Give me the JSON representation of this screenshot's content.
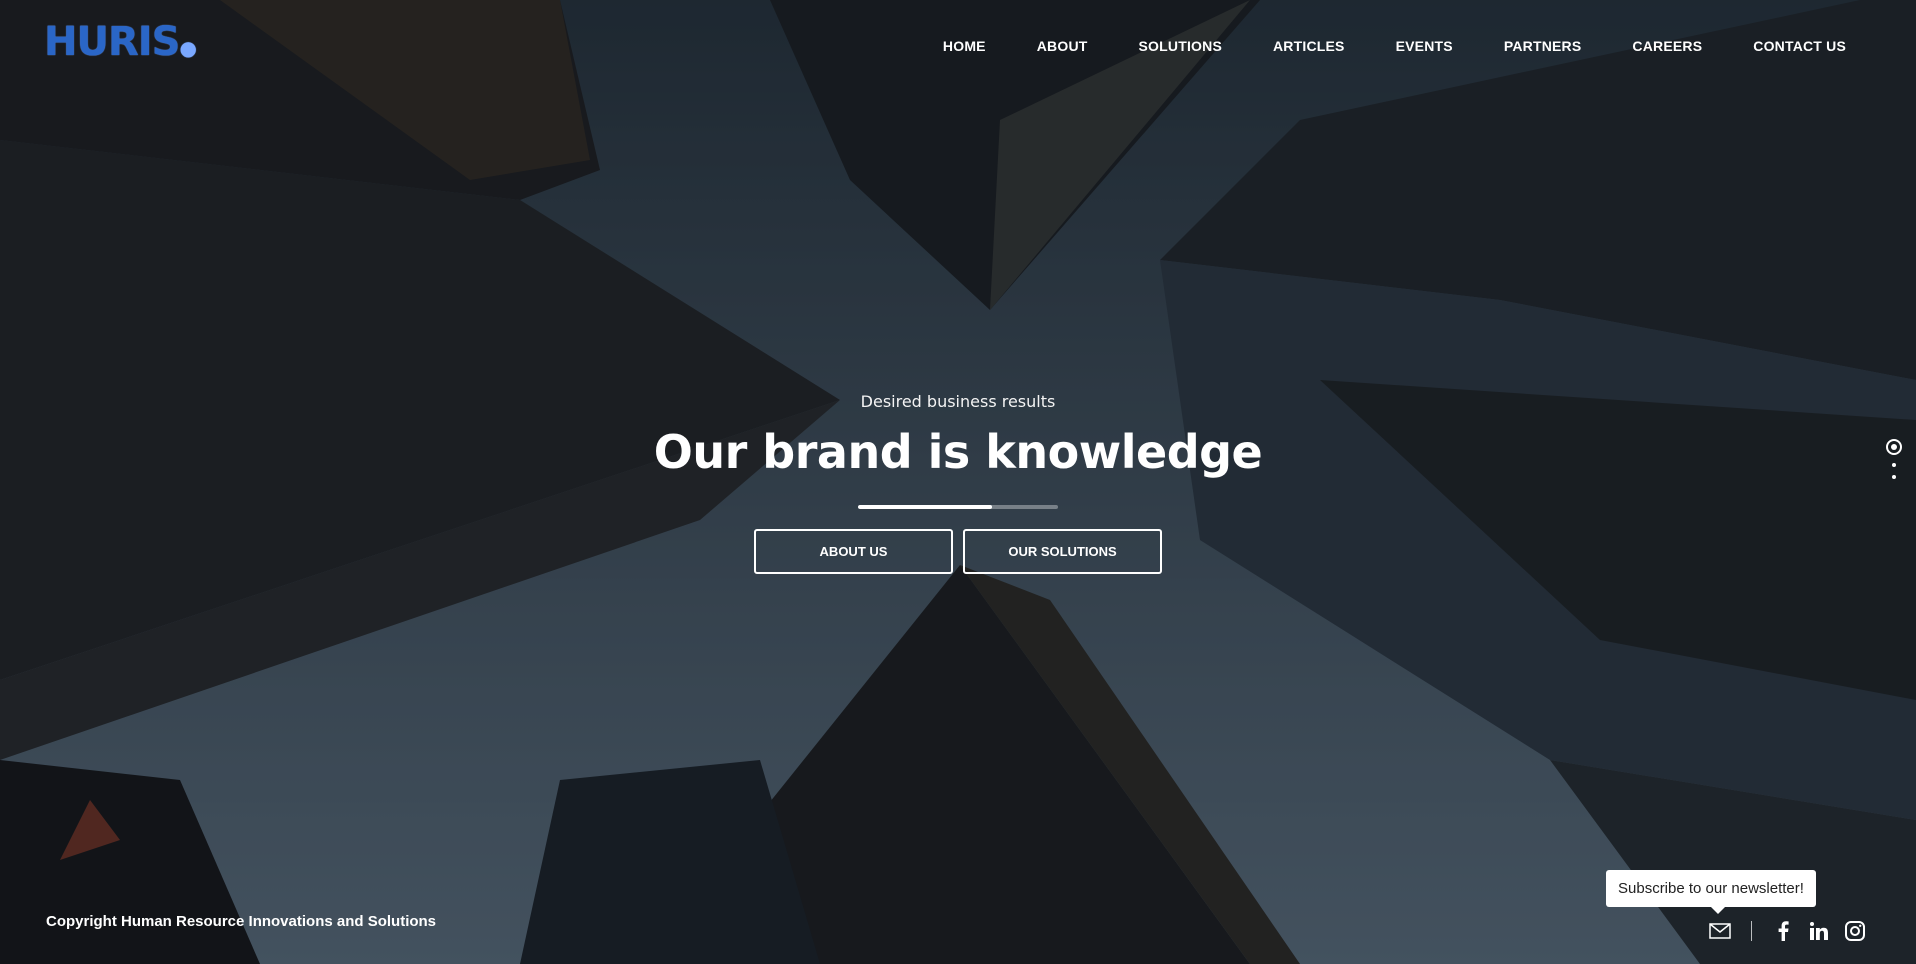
{
  "brand": {
    "logo_text": "HURIS"
  },
  "nav": {
    "items": [
      "HOME",
      "ABOUT",
      "SOLUTIONS",
      "ARTICLES",
      "EVENTS",
      "PARTNERS",
      "CAREERS",
      "CONTACT US"
    ]
  },
  "hero": {
    "kicker": "Desired business results",
    "title": "Our brand is knowledge",
    "slide_progress": 0.67,
    "buttons": {
      "about": "ABOUT US",
      "solutions": "OUR SOLUTIONS"
    }
  },
  "slider": {
    "slides": 3,
    "active": 1
  },
  "footer": {
    "copyright": "Copyright Human Resource Innovations and Solutions",
    "newsletter_tooltip": "Subscribe to our newsletter!",
    "social_icons": [
      "mail-icon",
      "facebook-icon",
      "linkedin-icon",
      "instagram-icon"
    ]
  },
  "colors": {
    "logo_blue": "#2a66c7",
    "text": "#ffffff"
  }
}
